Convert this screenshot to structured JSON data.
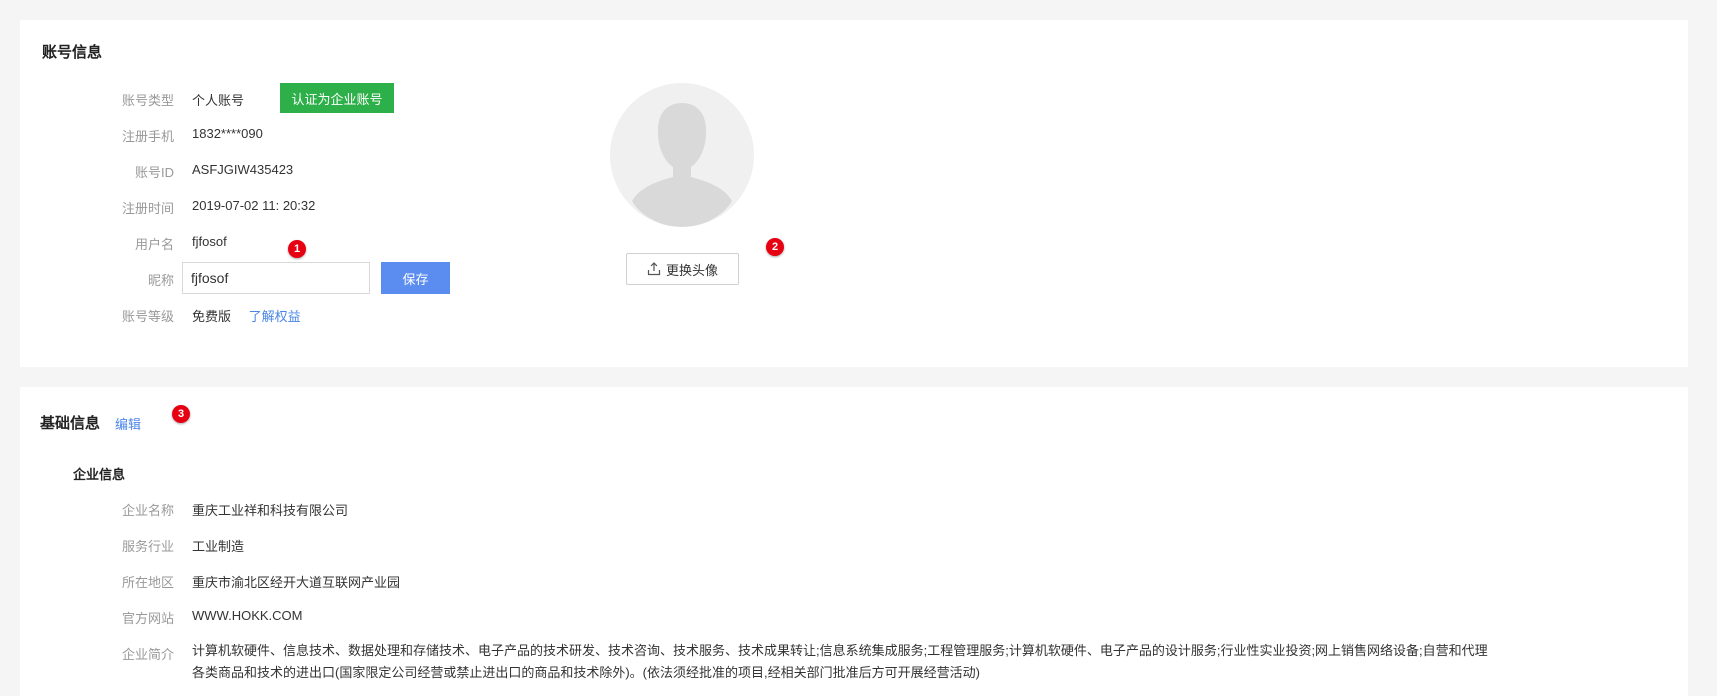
{
  "account": {
    "title": "账号信息",
    "fields": {
      "type_label": "账号类型",
      "type_value": "个人账号",
      "verify_button": "认证为企业账号",
      "phone_label": "注册手机",
      "phone_value": "1832****090",
      "id_label": "账号ID",
      "id_value": "ASFJGIW435423",
      "time_label": "注册时间",
      "time_value": "2019-07-02 11: 20:32",
      "username_label": "用户名",
      "username_value": "fjfosof",
      "nickname_label": "昵称",
      "nickname_value": "fjfosof",
      "save_button": "保存",
      "level_label": "账号等级",
      "level_value": "免费版",
      "level_link": "了解权益"
    },
    "avatar": {
      "icon": "user-silhouette-icon",
      "change_button": "更换头像",
      "upload_icon": "upload-icon"
    }
  },
  "markers": [
    "1",
    "2",
    "3"
  ],
  "basic": {
    "title": "基础信息",
    "edit_link": "编辑",
    "company_section_title": "企业信息",
    "fields": {
      "name_label": "企业名称",
      "name_value": "重庆工业祥和科技有限公司",
      "industry_label": "服务行业",
      "industry_value": "工业制造",
      "region_label": "所在地区",
      "region_value": "重庆市渝北区经开大道互联网产业园",
      "website_label": "官方网站",
      "website_value": "WWW.HOKK.COM",
      "intro_label": "企业简介",
      "intro_line1": "计算机软硬件、信息技术、数据处理和存储技术、电子产品的技术研发、技术咨询、技术服务、技术成果转让;信息系统集成服务;工程管理服务;计算机软硬件、电子产品的设计服务;行业性实业投资;网上销售网络设备;自营和代理",
      "intro_line2": "各类商品和技术的进出口(国家限定公司经营或禁止进出口的商品和技术除外)。(依法须经批准的项目,经相关部门批准后方可开展经营活动)"
    }
  },
  "colors": {
    "accent_green": "#2db049",
    "accent_blue": "#5b8cf0",
    "link_blue": "#4a86e8",
    "marker_red": "#e60012"
  }
}
